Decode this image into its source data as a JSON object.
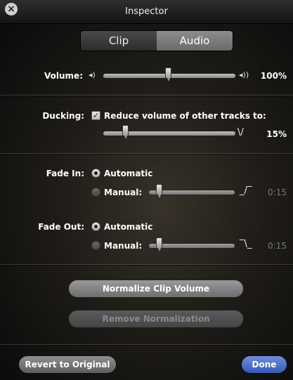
{
  "window": {
    "title": "Inspector"
  },
  "tabs": [
    {
      "label": "Clip",
      "active": false
    },
    {
      "label": "Audio",
      "active": true
    }
  ],
  "volume": {
    "label": "Volume:",
    "value": "100%",
    "level": 0.5
  },
  "ducking": {
    "label": "Ducking:",
    "checkbox_label": "Reduce volume of other tracks to:",
    "checked": true,
    "value": "15%",
    "level": 0.15
  },
  "fade_in": {
    "label": "Fade In:",
    "automatic_label": "Automatic",
    "manual_label": "Manual:",
    "selected": "Automatic",
    "value": "0:15"
  },
  "fade_out": {
    "label": "Fade Out:",
    "automatic_label": "Automatic",
    "manual_label": "Manual:",
    "selected": "Automatic",
    "value": "0:15"
  },
  "buttons": {
    "normalize": "Normalize Clip Volume",
    "remove_normalization": "Remove Normalization",
    "revert": "Revert to Original",
    "done": "Done"
  },
  "icons": {
    "close": "close-icon",
    "speaker_low": "speaker-low-icon",
    "speaker_high": "speaker-high-icon",
    "fade_in_curve": "fade-in-curve-icon",
    "fade_out_curve": "fade-out-curve-icon",
    "ducking_curve": "ducking-curve-icon"
  },
  "colors": {
    "done_button": "#3659b8"
  }
}
